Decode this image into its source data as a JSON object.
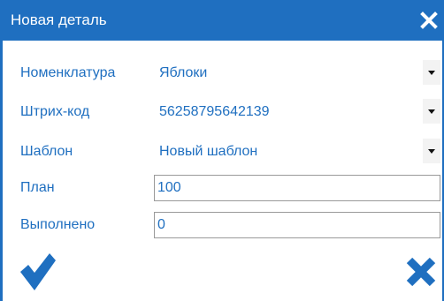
{
  "dialog": {
    "title": "Новая деталь",
    "close_icon": "close-icon",
    "accent_color": "#1f6fc0"
  },
  "fields": {
    "nomenclature": {
      "label": "Номенклатура",
      "value": "Яблоки"
    },
    "barcode": {
      "label": "Штрих-код",
      "value": "56258795642139"
    },
    "template": {
      "label": "Шаблон",
      "value": "Новый шаблон"
    },
    "plan": {
      "label": "План",
      "value": "100"
    },
    "done": {
      "label": "Выполнено",
      "value": "0"
    }
  },
  "actions": {
    "ok_icon": "checkmark-icon",
    "cancel_icon": "cross-icon"
  }
}
